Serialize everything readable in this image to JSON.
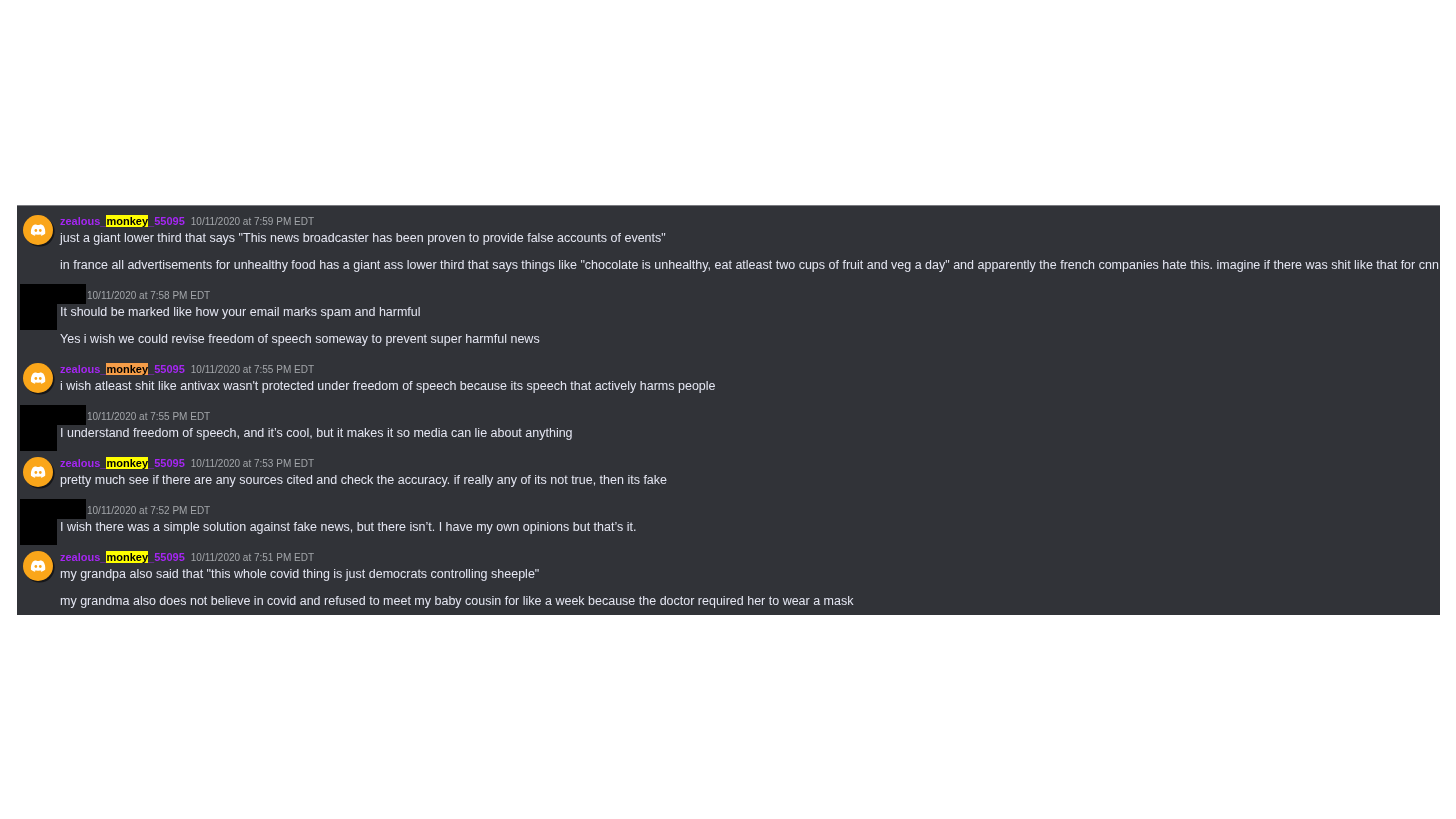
{
  "messages": [
    {
      "author": {
        "kind": "user",
        "name_before": "zealous_",
        "name_match": "monkey",
        "name_after": "_55095",
        "current_match": false
      },
      "timestamp": "10/11/2020 at 7:59 PM EDT",
      "lines": [
        "just a giant lower third that says \"This news broadcaster has been proven to provide false accounts of events\"",
        "in france all advertisements for unhealthy food has a giant ass lower third that says things like \"chocolate is unhealthy, eat atleast two cups of fruit and veg a day\" and apparently the french companies hate this. imagine if there was shit like that for cnn"
      ]
    },
    {
      "author": {
        "kind": "redacted"
      },
      "timestamp": "10/11/2020 at 7:58 PM EDT",
      "lines": [
        "It should be marked like how your email marks spam and harmful",
        "Yes i wish we could revise freedom of speech someway to prevent super harmful news"
      ]
    },
    {
      "author": {
        "kind": "user",
        "name_before": "zealous_",
        "name_match": "monkey",
        "name_after": "_55095",
        "current_match": true
      },
      "timestamp": "10/11/2020 at 7:55 PM EDT",
      "lines": [
        "i wish atleast shit like antivax wasn't protected under freedom of speech because its speech that actively harms people"
      ]
    },
    {
      "author": {
        "kind": "redacted"
      },
      "timestamp": "10/11/2020 at 7:55 PM EDT",
      "lines": [
        "I understand freedom of speech, and it’s cool, but it makes it so media can lie about anything"
      ]
    },
    {
      "author": {
        "kind": "user",
        "name_before": "zealous_",
        "name_match": "monkey",
        "name_after": "_55095",
        "current_match": false
      },
      "timestamp": "10/11/2020 at 7:53 PM EDT",
      "lines": [
        "pretty much see if there are any sources cited and check the accuracy. if really any of its not true, then its fake"
      ]
    },
    {
      "author": {
        "kind": "redacted"
      },
      "timestamp": "10/11/2020 at 7:52 PM EDT",
      "lines": [
        "I wish there was a simple solution against fake news, but there isn’t. I have my own opinions but that’s it."
      ]
    },
    {
      "author": {
        "kind": "user",
        "name_before": "zealous_",
        "name_match": "monkey",
        "name_after": "_55095",
        "current_match": false
      },
      "timestamp": "10/11/2020 at 7:51 PM EDT",
      "lines": [
        "my grandpa also said that \"this whole covid thing is just democrats controlling sheeple\"",
        "my grandma also does not believe in covid and refused to meet my baby cousin for like a week because the doctor required her to wear a mask"
      ]
    }
  ]
}
